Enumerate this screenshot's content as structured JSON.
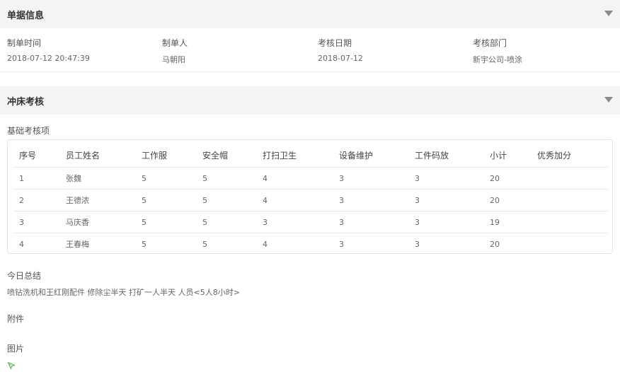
{
  "document_info": {
    "section_title": "单据信息",
    "fields": [
      {
        "label": "制单时间",
        "value": "2018-07-12 20:47:39"
      },
      {
        "label": "制单人",
        "value": "马朝阳"
      },
      {
        "label": "考核日期",
        "value": "2018-07-12"
      },
      {
        "label": "考核部门",
        "value": "新宇公司-喷涂"
      }
    ]
  },
  "punch_review": {
    "section_title": "冲床考核",
    "basic_items_label": "基础考核项",
    "table": {
      "headers": [
        "序号",
        "员工姓名",
        "工作服",
        "安全帽",
        "打扫卫生",
        "设备维护",
        "工件码放",
        "小计",
        "优秀加分"
      ],
      "rows": [
        [
          "1",
          "张魏",
          "5",
          "5",
          "4",
          "3",
          "3",
          "20",
          ""
        ],
        [
          "2",
          "王德浓",
          "5",
          "5",
          "4",
          "3",
          "3",
          "20",
          ""
        ],
        [
          "3",
          "马庆香",
          "5",
          "5",
          "3",
          "3",
          "3",
          "19",
          ""
        ],
        [
          "4",
          "王春梅",
          "5",
          "5",
          "4",
          "3",
          "3",
          "20",
          ""
        ]
      ]
    },
    "summary_label": "今日总结",
    "summary_text": "喷钻洗机和王红刚配件 修除尘半天 打矿一人半天 人员<5人8小时>",
    "attachment_label": "附件",
    "image_label": "图片",
    "image_icon": "image-placeholder-icon",
    "icon_color": "#5cb85c"
  }
}
